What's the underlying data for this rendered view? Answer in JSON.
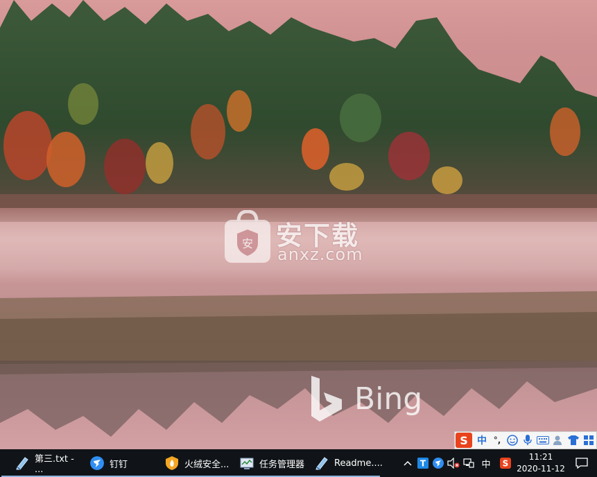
{
  "desktop": {
    "watermark_text": "安下载",
    "watermark_domain": "anxz.com",
    "bing_text": "Bing"
  },
  "ime_toolbar": {
    "logo": "S",
    "mode": "中",
    "punct": "°,",
    "icons": [
      "smile-icon",
      "microphone-icon",
      "keyboard-icon",
      "user-icon",
      "shirt-icon",
      "grid-icon"
    ]
  },
  "taskbar": {
    "tasks": [
      {
        "label": "第三.txt - ...",
        "icon": "notepad-icon",
        "color": "#7fb3e0"
      },
      {
        "label": "钉钉",
        "icon": "dingtalk-icon",
        "color": "#2f8ef2"
      },
      {
        "label": "火绒安全...",
        "icon": "huorong-icon",
        "color": "#f0a020"
      },
      {
        "label": "任务管理器",
        "icon": "task-manager-icon",
        "color": "#5c9bd6"
      },
      {
        "label": "Readme....",
        "icon": "notepad-icon",
        "color": "#7fb3e0"
      }
    ],
    "tray": {
      "chevron": "^",
      "ime_mode": "中",
      "time": "11:21",
      "date": "2020-11-12"
    }
  }
}
